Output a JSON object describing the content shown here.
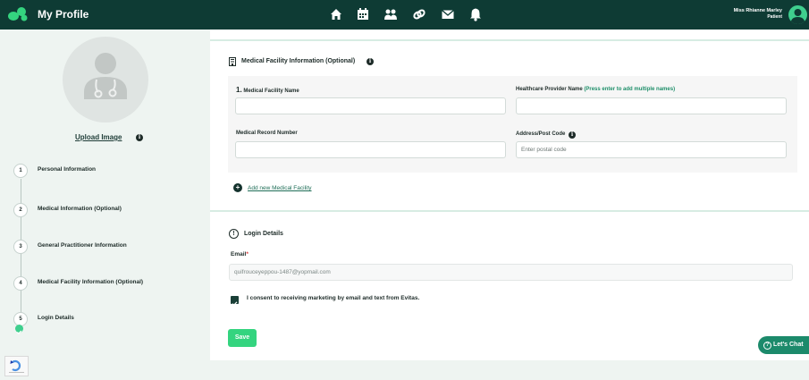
{
  "header": {
    "title": "My Profile",
    "nav_icons": [
      "home-icon",
      "calendar-icon",
      "people-icon",
      "link-icon",
      "mail-icon",
      "bell-icon"
    ],
    "user": {
      "name": "Miss Rhianne Marley",
      "role": "Patient"
    }
  },
  "sidebar": {
    "upload_label": "Upload Image",
    "upload_info": "i",
    "steps": [
      {
        "number": "1",
        "label": "Personal Information"
      },
      {
        "number": "2",
        "label": "Medical Information (Optional)"
      },
      {
        "number": "3",
        "label": "General Practitioner Information"
      },
      {
        "number": "4",
        "label": "Medical Facility Information (Optional)"
      },
      {
        "number": "5",
        "label": "Login Details"
      }
    ]
  },
  "facility": {
    "header": "Medical Facility Information (Optional)",
    "info": "i",
    "item_number": "1.",
    "name_label": "Medical Facility Name",
    "provider_label": "Healthcare Provider Name",
    "provider_hint": "(Press enter to add multiple names)",
    "record_label": "Medical Record Number",
    "address_label": "Address/Post Code",
    "address_info": "i",
    "address_placeholder": "Enter postal code",
    "add_facility": "Add new Medical Facility",
    "add_symbol": "+"
  },
  "login": {
    "header": "Login Details",
    "alert_symbol": "!",
    "email_label": "Email",
    "email_required": "*",
    "email_value": "quifrouceyeppou-1487@yopmail.com",
    "consent_text": "I consent to receiving marketing by email and text from Evitas.",
    "consent_checked": true
  },
  "actions": {
    "save_label": "Save",
    "chat_label": "Let's Chat",
    "chat_symbol": "?"
  },
  "colors": {
    "header_bg": "#0e3b34",
    "accent": "#34d47f",
    "chat": "#1c8a6b"
  }
}
